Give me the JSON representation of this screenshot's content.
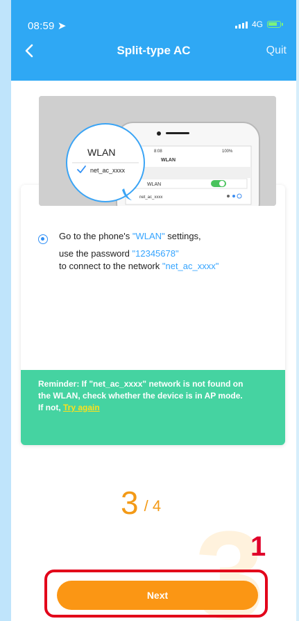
{
  "status": {
    "time": "08:59",
    "network": "4G"
  },
  "header": {
    "title": "Split-type AC",
    "quit_label": "Quit"
  },
  "illustration": {
    "zoom_title": "WLAN",
    "zoom_network": "net_ac_xxxx",
    "phone_time": "8:08",
    "phone_battery": "100%",
    "phone_title": "WLAN",
    "phone_wlan_label": "WLAN",
    "phone_network": "net_ac_xxxx"
  },
  "instruction": {
    "line1_prefix": "Go to the phone's ",
    "line1_highlight": "\"WLAN\"",
    "line1_suffix": " settings,",
    "line2_prefix": "use the password ",
    "line2_highlight": "\"12345678\"",
    "line3_prefix": "to connect to the network ",
    "line3_highlight": "\"net_ac_xxxx\""
  },
  "reminder": {
    "line1": "Reminder: If \"net_ac_xxxx\" network is not found on",
    "line2": "the WLAN, check whether the device is in AP mode.",
    "line3_prefix": "If not, ",
    "retry_label": "Try again"
  },
  "step": {
    "current": "3",
    "separator": "/",
    "total": "4",
    "watermark": "3"
  },
  "annotation": {
    "marker": "1"
  },
  "footer": {
    "next_label": "Next"
  },
  "colors": {
    "accent_blue": "#2fa8f4",
    "reminder_green": "#45d3a1",
    "orange": "#fb9614",
    "highlight_red": "#e2001a"
  }
}
